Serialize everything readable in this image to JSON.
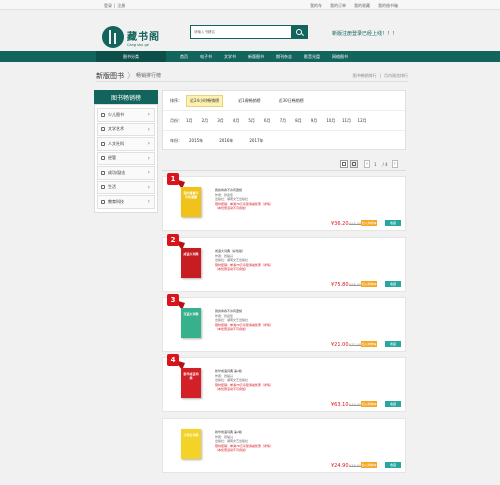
{
  "topbar": {
    "login": "登录",
    "sep": "|",
    "register": "注册",
    "links": [
      "我的车",
      "我的订单",
      "我的收藏",
      "我的借书箱"
    ]
  },
  "logo": {
    "cn": "藏书阁",
    "en": "Cang  shu  ge"
  },
  "search": {
    "placeholder": "请输入书籍名"
  },
  "promo": "新版注册登录已经上线！！！",
  "nav": {
    "category": "图书分类",
    "items": [
      "首页",
      "电子书",
      "文学书",
      "新版图书",
      "期刊杂志",
      "影音光盘",
      "网络图书"
    ]
  },
  "breadcrumb": {
    "title": "新版图书",
    "sep": "〉",
    "current": "畅销排行榜",
    "right1": "图书畅销排行",
    "right_sep": "|",
    "right2": "月内阅览排行"
  },
  "sidebar": {
    "title": "图书畅销榜",
    "items": [
      "少儿图书",
      "文学艺术",
      "人文社科",
      "经管",
      "成功/励志",
      "生活",
      "教育科技"
    ]
  },
  "filter": {
    "sort_label": "排序：",
    "sort_options": [
      "近24小时畅销榜",
      "近1周畅销榜",
      "近30日畅销榜"
    ],
    "month_label": "月份：",
    "months": [
      "1月",
      "2月",
      "3月",
      "4月",
      "5月",
      "6月",
      "7月",
      "8月",
      "9月",
      "10月",
      "11月",
      "12月"
    ],
    "year_label": "年份：",
    "years": [
      "2015年",
      "2016年",
      "2017年"
    ]
  },
  "pager": {
    "current": "1",
    "total": "/ 4"
  },
  "books": [
    {
      "rank": "1",
      "title": "我的青春不许有遗憾",
      "author": "作者：张嘉佳",
      "publisher": "出版社：湖南文艺出版社",
      "promo": "限时促销：单满78元享受满减优惠（详情）",
      "note": "（本优惠活动不可叠加）",
      "price": "¥36.20",
      "orig": "¥58.00",
      "cart": "加入购物车",
      "fav": "收藏",
      "cover_text": "我的青春不许有遗憾",
      "cover_color": "#f1c21a"
    },
    {
      "rank": "2",
      "title": "成语大词典（彩色版）",
      "author": "作者：张楚兴",
      "publisher": "出版社：湖南文艺出版社",
      "promo": "限时促销：单满78元享受满减优惠（详情）",
      "note": "（本优惠活动不可叠加）",
      "price": "¥75.80",
      "orig": "¥98.00",
      "cart": "加入购物车",
      "fav": "收藏",
      "cover_text": "成语大词典",
      "cover_color": "#c71c22"
    },
    {
      "rank": "3",
      "title": "我的青春不许有遗憾",
      "author": "作者：张嘉佳",
      "publisher": "出版社：湖南文艺出版社",
      "promo": "限时促销：单满78元享受满减优惠（详情）",
      "note": "（本优惠活动不可叠加）",
      "price": "¥21.00",
      "orig": "¥32.00",
      "cart": "加入购物车",
      "fav": "收藏",
      "cover_text": "汉语大词典",
      "cover_color": "#37b08c"
    },
    {
      "rank": "4",
      "title": "新华成语词典 第2版",
      "author": "作者：张楚兴",
      "publisher": "出版社：湖南文艺出版社",
      "promo": "限时促销：单满78元享受满减优惠（详情）",
      "note": "（本优惠活动不可叠加）",
      "price": "¥63.10",
      "orig": "¥79.00",
      "cart": "加入购物车",
      "fav": "收藏",
      "cover_text": "新华成语词典",
      "cover_color": "#d32026"
    },
    {
      "rank": "",
      "title": "新华成语词典 第2版",
      "author": "作者：张楚兴",
      "publisher": "出版社：湖南文艺出版社",
      "promo": "限时促销：单满78元享受满减优惠（详情）",
      "note": "（本优惠活动不可叠加）",
      "price": "¥24.90",
      "orig": "¥36.00",
      "cart": "加入购物车",
      "fav": "收藏",
      "cover_text": "小学生词典",
      "cover_color": "#f3d327"
    }
  ],
  "colors": {
    "brand": "#12645c",
    "accent_red": "#d9141b"
  }
}
